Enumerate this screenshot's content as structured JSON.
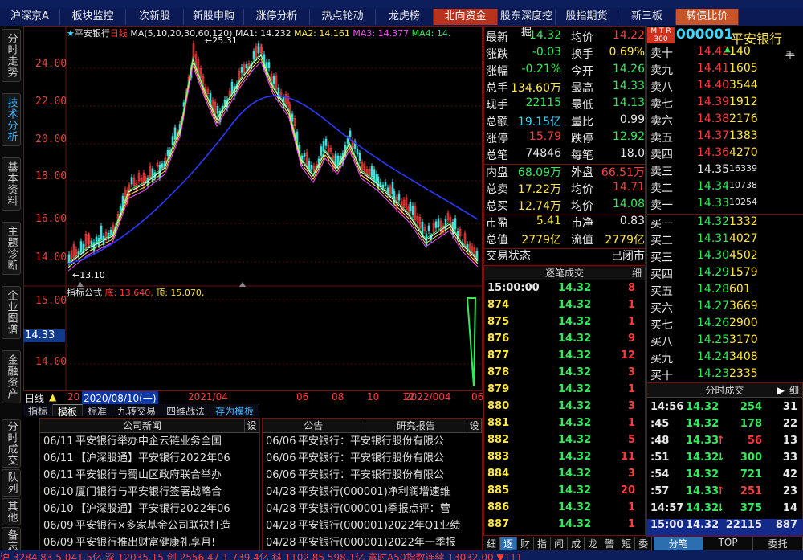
{
  "top_tabs": [
    {
      "label": "沪深京A",
      "style": ""
    },
    {
      "label": "板块监控",
      "style": ""
    },
    {
      "label": "次新股",
      "style": ""
    },
    {
      "label": "新股申购",
      "style": ""
    },
    {
      "label": "涨停分析",
      "style": ""
    },
    {
      "label": "热点轮动",
      "style": ""
    },
    {
      "label": "龙虎榜",
      "style": ""
    },
    {
      "label": "北向资金",
      "style": "red"
    },
    {
      "label": "股东深度挖掘",
      "style": ""
    },
    {
      "label": "股指期货",
      "style": ""
    },
    {
      "label": "新三板",
      "style": ""
    },
    {
      "label": "转债比价",
      "style": "org"
    }
  ],
  "side_tabs": [
    "分时走势",
    "技术分析",
    "基本资料",
    "主题诊断",
    "企业图谱",
    "金融资产"
  ],
  "side_tabs_lower": [
    "分时成交",
    "队列",
    "其他",
    "备忘"
  ],
  "chart": {
    "title": "平安银行",
    "period": "日线",
    "ma_label": "MA(5,10,20,30,60,120)",
    "ma1": "MA1: 14.232",
    "ma2": "MA2: 14.161",
    "ma3": "MA3: 14.377",
    "ma4": "MA4: 14.",
    "y_ticks": [
      "24.00",
      "22.00",
      "20.00",
      "18.00",
      "16.00",
      "14.00"
    ],
    "high_label": "25.31",
    "low_label": "13.10",
    "indicator_title": "指标公式",
    "indicator_bottom": "底: 13.640,",
    "indicator_top": "顶: 15.070,",
    "sub_y_ticks": [
      "15.00",
      "14.00"
    ],
    "sub_current": "14.33",
    "x_dates": [
      "20",
      "2020/08/10(一)",
      "2021/04",
      "06",
      "08",
      "10",
      "12",
      "2022/004",
      "06"
    ],
    "period_tag": "日线"
  },
  "chart_tabs": [
    "指标",
    "模板",
    "标准",
    "九转交易",
    "四维战法",
    "存为模板"
  ],
  "news_panel": {
    "title": "公司新闻",
    "set": "设",
    "items": [
      {
        "date": "06/11",
        "text": "平安银行举办中企云链业务全国"
      },
      {
        "date": "06/11",
        "text": "【沪深股通】平安银行2022年06"
      },
      {
        "date": "06/11",
        "text": "平安银行与蜀山区政府联合举办"
      },
      {
        "date": "06/10",
        "text": "厦门银行与平安银行签署战略合"
      },
      {
        "date": "06/10",
        "text": "【沪深股通】平安银行2022年06"
      },
      {
        "date": "06/09",
        "text": "平安银行×多家基金公司联袂打造"
      },
      {
        "date": "06/09",
        "text": "平安银行推出财富健康礼享月!"
      }
    ]
  },
  "notice_panel": {
    "title1": "公告",
    "title2": "研究报告",
    "set": "设",
    "items": [
      {
        "date": "06/06",
        "text": "平安银行：平安银行股份有限公"
      },
      {
        "date": "06/06",
        "text": "平安银行：平安银行股份有限公"
      },
      {
        "date": "06/06",
        "text": "平安银行：平安银行股份有限公"
      },
      {
        "date": "04/28",
        "text": "平安银行(000001)净利润增速维"
      },
      {
        "date": "04/28",
        "text": "平安银行(000001)季报点评：营"
      },
      {
        "date": "04/28",
        "text": "平安银行(000001)2022年Q1业绩"
      },
      {
        "date": "04/28",
        "text": "平安银行(000001)2022年一季报"
      }
    ]
  },
  "quote": {
    "rows": [
      {
        "l1": "最新",
        "v1": "14.32",
        "c1": "grn",
        "l2": "均价",
        "v2": "14.22",
        "c2": "red"
      },
      {
        "l1": "涨跌",
        "v1": "-0.03",
        "c1": "grn",
        "l2": "换手",
        "v2": "0.69%",
        "c2": "yel"
      },
      {
        "l1": "涨幅",
        "v1": "-0.21%",
        "c1": "grn",
        "l2": "今开",
        "v2": "14.26",
        "c2": "grn"
      },
      {
        "l1": "总手",
        "v1": "134.60万",
        "c1": "yel",
        "l2": "最高",
        "v2": "14.33",
        "c2": "grn"
      },
      {
        "l1": "现手",
        "v1": "22115",
        "c1": "grn",
        "l2": "最低",
        "v2": "14.13",
        "c2": "grn"
      },
      {
        "l1": "总额",
        "v1": "19.15亿",
        "c1": "cyan",
        "l2": "量比",
        "v2": "0.99",
        "c2": "wht"
      },
      {
        "l1": "涨停",
        "v1": "15.79",
        "c1": "red",
        "l2": "跌停",
        "v2": "12.92",
        "c2": "grn"
      },
      {
        "l1": "总笔",
        "v1": "74846",
        "c1": "wht",
        "l2": "每笔",
        "v2": "18.0",
        "c2": "wht"
      },
      {
        "l1": "内盘",
        "v1": "68.09万",
        "c1": "grn",
        "l2": "外盘",
        "v2": "66.51万",
        "c2": "red"
      },
      {
        "l1": "总卖",
        "v1": "17.22万",
        "c1": "yel",
        "l2": "均价",
        "v2": "14.71",
        "c2": "red"
      },
      {
        "l1": "总买",
        "v1": "12.74万",
        "c1": "yel",
        "l2": "均价",
        "v2": "14.08",
        "c2": "grn"
      },
      {
        "l1": "市盈",
        "v1": "5.41",
        "c1": "yel",
        "l2": "市净",
        "v2": "0.83",
        "c2": "wht"
      },
      {
        "l1": "总值",
        "v1": "2779亿",
        "c1": "yel",
        "l2": "流值",
        "v2": "2779亿",
        "c2": "yel"
      },
      {
        "l1": "交易状态",
        "v1": "",
        "c1": "wht",
        "l2": "",
        "v2": "已闭市",
        "c2": "wht"
      }
    ]
  },
  "stock_header": {
    "code": "000001",
    "name": "平安银行",
    "badge_top": "M T R",
    "badge_bottom": "300",
    "extra": "手"
  },
  "book": {
    "sell": [
      {
        "label": "卖十",
        "price": "14.42",
        "vol": "140",
        "flag": "up"
      },
      {
        "label": "卖九",
        "price": "14.41",
        "vol": "1605",
        "flag": ""
      },
      {
        "label": "卖八",
        "price": "14.40",
        "vol": "3544",
        "flag": ""
      },
      {
        "label": "卖七",
        "price": "14.39",
        "vol": "1912",
        "flag": ""
      },
      {
        "label": "卖六",
        "price": "14.38",
        "vol": "2176",
        "flag": ""
      },
      {
        "label": "卖五",
        "price": "14.37",
        "vol": "1383",
        "flag": ""
      },
      {
        "label": "卖四",
        "price": "14.36",
        "vol": "4270",
        "flag": ""
      },
      {
        "label": "卖三",
        "price": "14.35",
        "vol": "16339",
        "flag": ""
      },
      {
        "label": "卖二",
        "price": "14.34",
        "vol": "10738",
        "flag": ""
      },
      {
        "label": "卖一",
        "price": "14.33",
        "vol": "10254",
        "flag": ""
      }
    ],
    "buy": [
      {
        "label": "买一",
        "price": "14.32",
        "vol": "1332"
      },
      {
        "label": "买二",
        "price": "14.31",
        "vol": "4027"
      },
      {
        "label": "买三",
        "price": "14.30",
        "vol": "4502"
      },
      {
        "label": "买四",
        "price": "14.29",
        "vol": "1579"
      },
      {
        "label": "买五",
        "price": "14.28",
        "vol": "601"
      },
      {
        "label": "买六",
        "price": "14.27",
        "vol": "3669"
      },
      {
        "label": "买七",
        "price": "14.26",
        "vol": "2900"
      },
      {
        "label": "买八",
        "price": "14.25",
        "vol": "3170"
      },
      {
        "label": "买九",
        "price": "14.24",
        "vol": "3408"
      },
      {
        "label": "买十",
        "price": "14.23",
        "vol": "2335"
      }
    ]
  },
  "trades": {
    "title": "逐笔成交",
    "detail": "细",
    "rows": [
      {
        "id": "15:00:00",
        "price": "14.32",
        "vol": "8"
      },
      {
        "id": "874",
        "price": "14.32",
        "vol": "1"
      },
      {
        "id": "875",
        "price": "14.32",
        "vol": "1"
      },
      {
        "id": "876",
        "price": "14.32",
        "vol": "9"
      },
      {
        "id": "877",
        "price": "14.32",
        "vol": "12"
      },
      {
        "id": "878",
        "price": "14.32",
        "vol": "3"
      },
      {
        "id": "879",
        "price": "14.32",
        "vol": "1"
      },
      {
        "id": "880",
        "price": "14.32",
        "vol": "3"
      },
      {
        "id": "881",
        "price": "14.32",
        "vol": "1"
      },
      {
        "id": "882",
        "price": "14.32",
        "vol": "5"
      },
      {
        "id": "883",
        "price": "14.32",
        "vol": "11"
      },
      {
        "id": "884",
        "price": "14.32",
        "vol": "3"
      },
      {
        "id": "885",
        "price": "14.32",
        "vol": "20"
      },
      {
        "id": "886",
        "price": "14.32",
        "vol": "1"
      },
      {
        "id": "887",
        "price": "14.32",
        "vol": "1"
      }
    ]
  },
  "ticks": {
    "title": "分时成交",
    "detail": "细",
    "rows": [
      {
        "time": "14:56",
        "price": "14.32",
        "pc": "grn",
        "arrow": "",
        "vol": "254",
        "vc": "grn",
        "n": "31"
      },
      {
        "time": ":45",
        "price": "14.32",
        "pc": "grn",
        "arrow": "",
        "vol": "178",
        "vc": "grn",
        "n": "22"
      },
      {
        "time": ":48",
        "price": "14.33",
        "pc": "grn",
        "arrow": "↑",
        "vol": "56",
        "vc": "red",
        "n": "13"
      },
      {
        "time": ":51",
        "price": "14.32",
        "pc": "grn",
        "arrow": "↓",
        "vol": "300",
        "vc": "grn",
        "n": "33"
      },
      {
        "time": ":54",
        "price": "14.32",
        "pc": "grn",
        "arrow": "",
        "vol": "721",
        "vc": "grn",
        "n": "42"
      },
      {
        "time": ":57",
        "price": "14.33",
        "pc": "grn",
        "arrow": "↑",
        "vol": "251",
        "vc": "red",
        "n": "23"
      },
      {
        "time": "14:57",
        "price": "14.32",
        "pc": "grn",
        "arrow": "↓",
        "vol": "375",
        "vc": "grn",
        "n": "14"
      },
      {
        "time": "15:00",
        "price": "14.32",
        "pc": "wht",
        "arrow": "",
        "vol": "22115",
        "vc": "wht",
        "n": "887"
      }
    ]
  },
  "bottom_tabs": [
    "细",
    "逐",
    "财",
    "指",
    "闻",
    "成",
    "龙",
    "警",
    "短",
    "委"
  ],
  "bottom_tabs2": [
    "分笔",
    "TOP",
    "委托"
  ],
  "status": "沪  3284.83  5.041.5亿 深  12035.15  创  2556.47  1.739.4亿 科  1102.85  598.1亿 富时A50指数连续  13032.00  ▼111"
}
